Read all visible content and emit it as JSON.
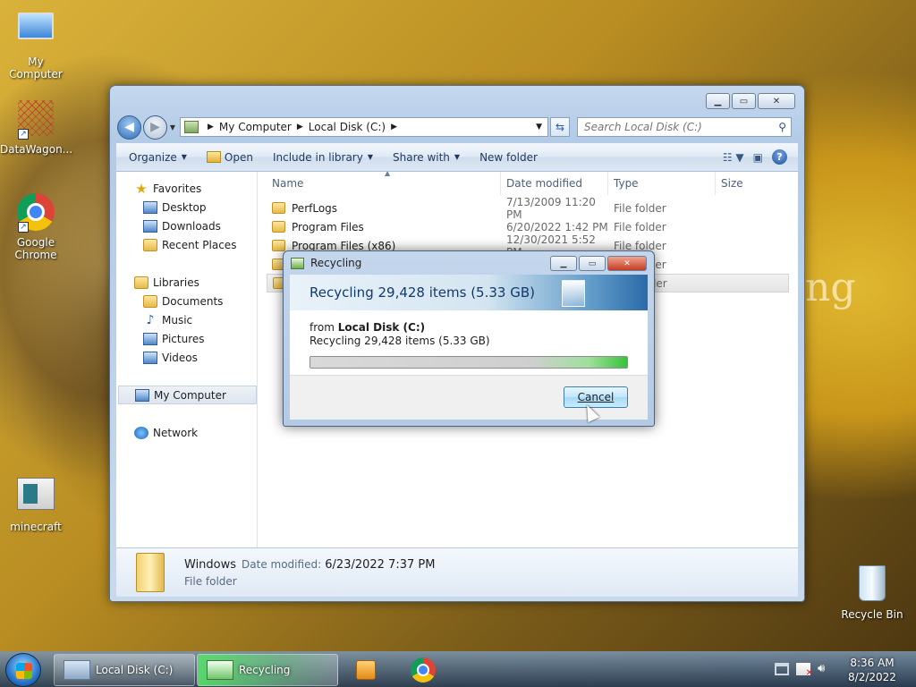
{
  "desktop": {
    "icons": [
      {
        "label": "My Computer",
        "icon": "my-computer-icon"
      },
      {
        "label": "DataWagon...",
        "icon": "datawagon-icon"
      },
      {
        "label": "Google Chrome",
        "icon": "chrome-icon"
      },
      {
        "label": "minecraft",
        "icon": "minecraft-icon"
      },
      {
        "label": "Recycle Bin",
        "icon": "recycle-bin-icon"
      }
    ],
    "wallpaper_text": "ng"
  },
  "explorer": {
    "breadcrumb": [
      "My Computer",
      "Local Disk (C:)"
    ],
    "search_placeholder": "Search Local Disk (C:)",
    "toolbar": {
      "organize": "Organize",
      "open": "Open",
      "include_in_library": "Include in library",
      "share_with": "Share with",
      "new_folder": "New folder"
    },
    "nav": {
      "favorites": "Favorites",
      "favorites_items": [
        "Desktop",
        "Downloads",
        "Recent Places"
      ],
      "libraries": "Libraries",
      "libraries_items": [
        "Documents",
        "Music",
        "Pictures",
        "Videos"
      ],
      "my_computer": "My Computer",
      "network": "Network"
    },
    "columns": {
      "name": "Name",
      "date_modified": "Date modified",
      "type": "Type",
      "size": "Size"
    },
    "rows": [
      {
        "name": "PerfLogs",
        "date": "7/13/2009 11:20 PM",
        "type": "File folder"
      },
      {
        "name": "Program Files",
        "date": "6/20/2022 1:42 PM",
        "type": "File folder"
      },
      {
        "name": "Program Files (x86)",
        "date": "12/30/2021 5:52 PM",
        "type": "File folder"
      },
      {
        "name": "",
        "date": "",
        "type": "File folder"
      },
      {
        "name": "",
        "date": "",
        "type": "File folder"
      }
    ],
    "details": {
      "name": "Windows",
      "date_label": "Date modified:",
      "date_value": "6/23/2022 7:37 PM",
      "type": "File folder"
    }
  },
  "dialog": {
    "title": "Recycling",
    "headline": "Recycling 29,428 items (5.33 GB)",
    "from_label": "from",
    "from_value": "Local Disk (C:)",
    "status": "Recycling 29,428 items (5.33 GB)",
    "progress": 1.0,
    "cancel": "Cancel"
  },
  "taskbar": {
    "tasks": [
      {
        "label": "Local Disk (C:)"
      },
      {
        "label": "Recycling"
      }
    ],
    "clock_time": "8:36 AM",
    "clock_date": "8/2/2022"
  }
}
